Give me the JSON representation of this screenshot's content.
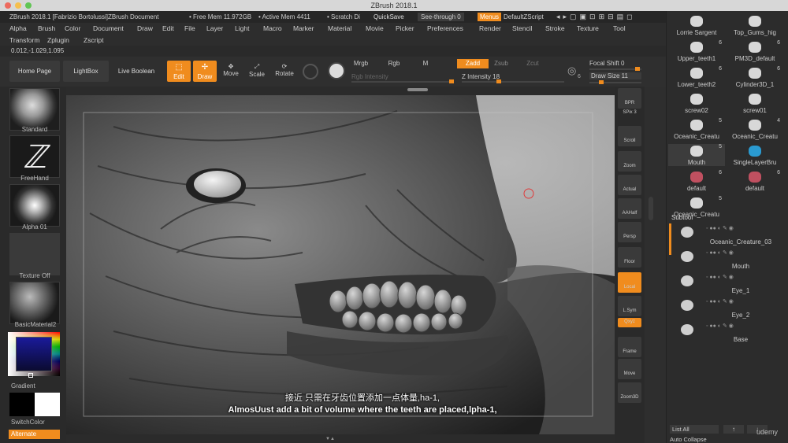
{
  "app": {
    "window_title": "ZBrush 2018.1"
  },
  "infobar": {
    "doc_title": "ZBrush 2018.1 [Fabrizio Bortolussi]ZBrush Document",
    "free_mem": "• Free Mem 11.972GB",
    "active_mem": "• Active Mem 4411",
    "scratch": "• Scratch Di",
    "quicksave": "QuickSave",
    "see_through": "See-through  0",
    "menus": "Menus",
    "default_zscript": "DefaultZScript"
  },
  "menus": [
    "Alpha",
    "Brush",
    "Color",
    "Document",
    "Draw",
    "Edit",
    "File",
    "Layer",
    "Light",
    "Macro",
    "Marker",
    "Material",
    "Movie",
    "Picker",
    "Preferences",
    "Render",
    "Stencil",
    "Stroke",
    "Texture",
    "Tool"
  ],
  "menus2": [
    "Transform",
    "Zplugin",
    "Zscript"
  ],
  "coords": "0.012,-1.029,1.095",
  "toolbar": {
    "home_page": "Home Page",
    "lightbox": "LightBox",
    "live_boolean": "Live Boolean",
    "edit": "Edit",
    "draw": "Draw",
    "move": "Move",
    "scale": "Scale",
    "rotate": "Rotate",
    "mrgb": "Mrgb",
    "rgb": "Rgb",
    "m": "M",
    "zadd": "Zadd",
    "zsub": "Zsub",
    "zcut": "Zcut",
    "rgb_intensity": "Rgb Intensity",
    "z_intensity": "Z Intensity 18",
    "focal_shift": "Focal Shift 0",
    "draw_size": "Draw Size 11",
    "dynamic_num": "6"
  },
  "left_shelf": {
    "brush": "Standard",
    "stroke": "FreeHand",
    "alpha": "Alpha 01",
    "texture": "Texture Off",
    "material": "BasicMaterial2",
    "gradient": "Gradient",
    "switch_color": "SwitchColor",
    "alternate": "Alternate"
  },
  "right_shelf": [
    "BPR",
    "SPix 3",
    "Scroll",
    "Zoom",
    "Actual",
    "AAHalf",
    "Persp",
    "Floor",
    "Local",
    "L.Sym",
    "Qxyz",
    "Frame",
    "Move",
    "Zoom3D"
  ],
  "tool_tray": [
    {
      "name": "Lorrie Sargent",
      "num": ""
    },
    {
      "name": "Top_Gums_hig",
      "num": ""
    },
    {
      "name": "Upper_teeth1",
      "num": "6"
    },
    {
      "name": "PM3D_default",
      "num": "6"
    },
    {
      "name": "Lower_teeth2",
      "num": "6"
    },
    {
      "name": "Cylinder3D_1",
      "num": "6"
    },
    {
      "name": "screw02",
      "num": ""
    },
    {
      "name": "screw01",
      "num": ""
    },
    {
      "name": "Oceanic_Creatu",
      "num": "5"
    },
    {
      "name": "Oceanic_Creatu",
      "num": "4"
    },
    {
      "name": "Mouth",
      "num": "5"
    },
    {
      "name": "SingleLayerBru",
      "num": ""
    },
    {
      "name": "default",
      "num": "6"
    },
    {
      "name": "default",
      "num": "6"
    },
    {
      "name": "Oceanic_Creatu",
      "num": "5"
    }
  ],
  "subtool": {
    "title": "Subtool",
    "items": [
      "Oceanic_Creature_03",
      "Mouth",
      "Eye_1",
      "Eye_2",
      "Base"
    ],
    "list_all": "List All",
    "auto_collapse": "Auto Collapse"
  },
  "subtitles": {
    "chinese": "接近 只需在牙齿位置添加一点体量,ha-1,",
    "english": "AlmosUust add a bit of volume where the teeth are placed,lpha-1,"
  },
  "watermark": "udemy",
  "colors": {
    "accent": "#f08c1e",
    "panel": "#2b2b2b"
  }
}
